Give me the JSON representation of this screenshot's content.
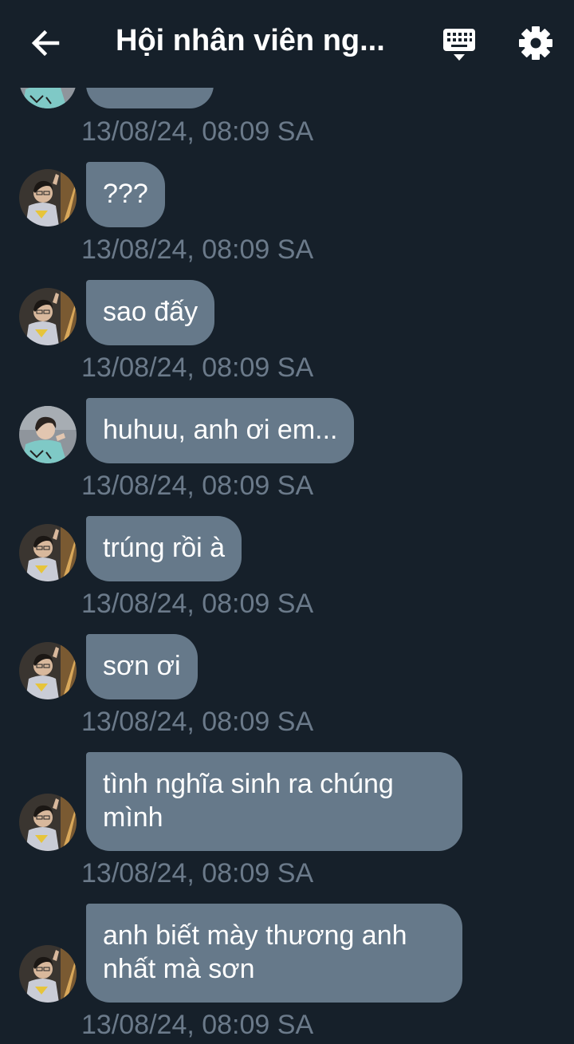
{
  "header": {
    "title": "Hội nhân viên ng..."
  },
  "icons": {
    "back": "arrow-left-icon",
    "keyboard": "keyboard-icon",
    "settings": "gear-icon"
  },
  "colors": {
    "background": "#16202a",
    "bubble": "#66798a",
    "timestamp": "#6b7a8a",
    "text": "#ffffff"
  },
  "messages": [
    {
      "text": "",
      "time": "13/08/24, 08:09 SA",
      "avatar": "avatar-b"
    },
    {
      "text": "???",
      "time": "13/08/24, 08:09 SA",
      "avatar": "avatar-a"
    },
    {
      "text": "sao đấy",
      "time": "13/08/24, 08:09 SA",
      "avatar": "avatar-a"
    },
    {
      "text": "huhuu, anh ơi em...",
      "time": "13/08/24, 08:09 SA",
      "avatar": "avatar-b"
    },
    {
      "text": "trúng rồi à",
      "time": "13/08/24, 08:09 SA",
      "avatar": "avatar-a"
    },
    {
      "text": "sơn ơi",
      "time": "13/08/24, 08:09 SA",
      "avatar": "avatar-a"
    },
    {
      "text": "tình nghĩa sinh ra chúng mình",
      "time": "13/08/24, 08:09 SA",
      "avatar": "avatar-a"
    },
    {
      "text": "anh biết mày thương anh nhất mà sơn",
      "time": "13/08/24, 08:09 SA",
      "avatar": "avatar-a"
    }
  ]
}
